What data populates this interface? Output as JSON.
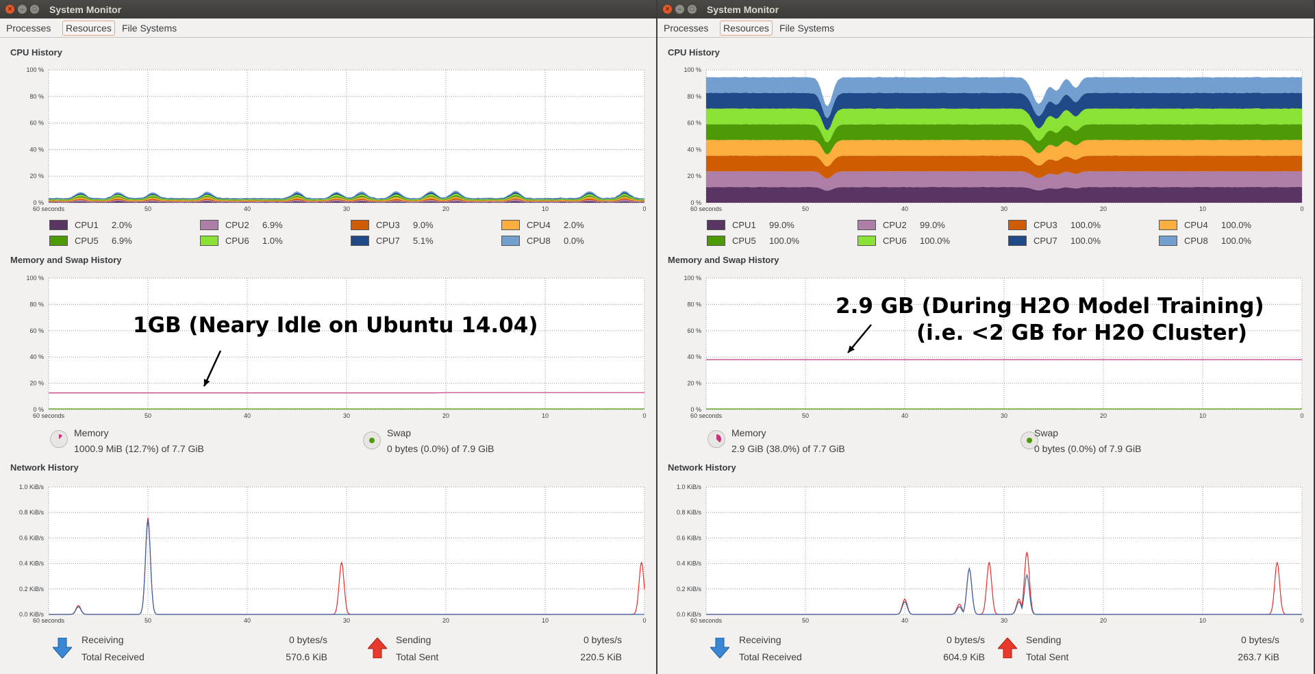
{
  "windows": [
    {
      "title": "System Monitor",
      "tabs": [
        "Processes",
        "Resources",
        "File Systems"
      ],
      "active_tab": "Resources",
      "sections": {
        "cpu": "CPU History",
        "mem": "Memory and Swap History",
        "net": "Network History"
      },
      "cpu_chart": {
        "x_ticks": [
          "60 seconds",
          "50",
          "40",
          "30",
          "20",
          "10",
          "0"
        ],
        "y_ticks": [
          "100 %",
          "80 %",
          "60 %",
          "40 %",
          "20 %",
          "0 %"
        ]
      },
      "cpus": [
        {
          "label": "CPU1",
          "value": "2.0%",
          "color": "#5a3462"
        },
        {
          "label": "CPU2",
          "value": "6.9%",
          "color": "#ad7fa8"
        },
        {
          "label": "CPU3",
          "value": "9.0%",
          "color": "#ce5c00"
        },
        {
          "label": "CPU4",
          "value": "2.0%",
          "color": "#fcaf3e"
        },
        {
          "label": "CPU5",
          "value": "6.9%",
          "color": "#4e9a06"
        },
        {
          "label": "CPU6",
          "value": "1.0%",
          "color": "#8ae234"
        },
        {
          "label": "CPU7",
          "value": "5.1%",
          "color": "#204a87"
        },
        {
          "label": "CPU8",
          "value": "0.0%",
          "color": "#729fcf"
        }
      ],
      "cpu_mode": "idle",
      "mem_chart": {
        "x_ticks": [
          "60 seconds",
          "50",
          "40",
          "30",
          "20",
          "10",
          "0"
        ],
        "y_ticks": [
          "100 %",
          "80 %",
          "60 %",
          "40 %",
          "20 %",
          "0 %"
        ],
        "memory_percent": 12.7
      },
      "memory": {
        "label": "Memory",
        "value": "1000.9 MiB (12.7%) of 7.7 GiB",
        "color": "#c4347a"
      },
      "swap": {
        "label": "Swap",
        "value": "0 bytes (0.0%) of 7.9 GiB",
        "color": "#4e9a06"
      },
      "annotation": [
        "1GB (Neary  Idle  on Ubuntu 14.04)"
      ],
      "net_chart": {
        "x_ticks": [
          "60 seconds",
          "50",
          "40",
          "30",
          "20",
          "10",
          "0"
        ],
        "y_ticks": [
          "1.0 KiB/s",
          "0.8 KiB/s",
          "0.6 KiB/s",
          "0.4 KiB/s",
          "0.2 KiB/s",
          "0.0 KiB/s"
        ],
        "recv_peaks": [
          {
            "t": 57,
            "v": 0.06
          },
          {
            "t": 50,
            "v": 0.74
          }
        ],
        "send_peaks": [
          {
            "t": 57,
            "v": 0.07
          },
          {
            "t": 50,
            "v": 0.76
          },
          {
            "t": 30.5,
            "v": 0.41
          },
          {
            "t": 0.3,
            "v": 0.41
          }
        ]
      },
      "network": {
        "receiving_label": "Receiving",
        "receiving_value": "0 bytes/s",
        "total_received_label": "Total Received",
        "total_received_value": "570.6 KiB",
        "sending_label": "Sending",
        "sending_value": "0 bytes/s",
        "total_sent_label": "Total Sent",
        "total_sent_value": "220.5 KiB"
      }
    },
    {
      "title": "System Monitor",
      "tabs": [
        "Processes",
        "Resources",
        "File Systems"
      ],
      "active_tab": "Resources",
      "sections": {
        "cpu": "CPU History",
        "mem": "Memory and Swap History",
        "net": "Network History"
      },
      "cpu_chart": {
        "x_ticks": [
          "60 seconds",
          "50",
          "40",
          "30",
          "20",
          "10",
          "0"
        ],
        "y_ticks": [
          "100 %",
          "80 %",
          "60 %",
          "40 %",
          "20 %",
          "0 %"
        ]
      },
      "cpus": [
        {
          "label": "CPU1",
          "value": "99.0%",
          "color": "#5a3462"
        },
        {
          "label": "CPU2",
          "value": "99.0%",
          "color": "#ad7fa8"
        },
        {
          "label": "CPU3",
          "value": "100.0%",
          "color": "#ce5c00"
        },
        {
          "label": "CPU4",
          "value": "100.0%",
          "color": "#fcaf3e"
        },
        {
          "label": "CPU5",
          "value": "100.0%",
          "color": "#4e9a06"
        },
        {
          "label": "CPU6",
          "value": "100.0%",
          "color": "#8ae234"
        },
        {
          "label": "CPU7",
          "value": "100.0%",
          "color": "#204a87"
        },
        {
          "label": "CPU8",
          "value": "100.0%",
          "color": "#729fcf"
        }
      ],
      "cpu_mode": "busy",
      "mem_chart": {
        "x_ticks": [
          "60 seconds",
          "50",
          "40",
          "30",
          "20",
          "10",
          "0"
        ],
        "y_ticks": [
          "100 %",
          "80 %",
          "60 %",
          "40 %",
          "20 %",
          "0 %"
        ],
        "memory_percent": 38.0
      },
      "memory": {
        "label": "Memory",
        "value": "2.9 GiB (38.0%) of 7.7 GiB",
        "color": "#c4347a"
      },
      "swap": {
        "label": "Swap",
        "value": "0 bytes (0.0%) of 7.9 GiB",
        "color": "#4e9a06"
      },
      "annotation": [
        "2.9 GB (During  H2O  Model Training)",
        "(i.e. <2  GB  for  H2O Cluster)"
      ],
      "net_chart": {
        "x_ticks": [
          "60 seconds",
          "50",
          "40",
          "30",
          "20",
          "10",
          "0"
        ],
        "y_ticks": [
          "1.0 KiB/s",
          "0.8 KiB/s",
          "0.6 KiB/s",
          "0.4 KiB/s",
          "0.2 KiB/s",
          "0.0 KiB/s"
        ],
        "recv_peaks": [
          {
            "t": 40,
            "v": 0.1
          },
          {
            "t": 34.5,
            "v": 0.06
          },
          {
            "t": 33.5,
            "v": 0.36
          },
          {
            "t": 28.5,
            "v": 0.1
          },
          {
            "t": 27.7,
            "v": 0.31
          }
        ],
        "send_peaks": [
          {
            "t": 40,
            "v": 0.12
          },
          {
            "t": 34.5,
            "v": 0.08
          },
          {
            "t": 33.5,
            "v": 0.36
          },
          {
            "t": 31.5,
            "v": 0.41
          },
          {
            "t": 28.5,
            "v": 0.12
          },
          {
            "t": 27.7,
            "v": 0.49
          },
          {
            "t": 2.5,
            "v": 0.41
          }
        ]
      },
      "network": {
        "receiving_label": "Receiving",
        "receiving_value": "0 bytes/s",
        "total_received_label": "Total Received",
        "total_received_value": "604.9 KiB",
        "sending_label": "Sending",
        "sending_value": "0 bytes/s",
        "total_sent_label": "Total Sent",
        "total_sent_value": "263.7 KiB"
      }
    }
  ]
}
